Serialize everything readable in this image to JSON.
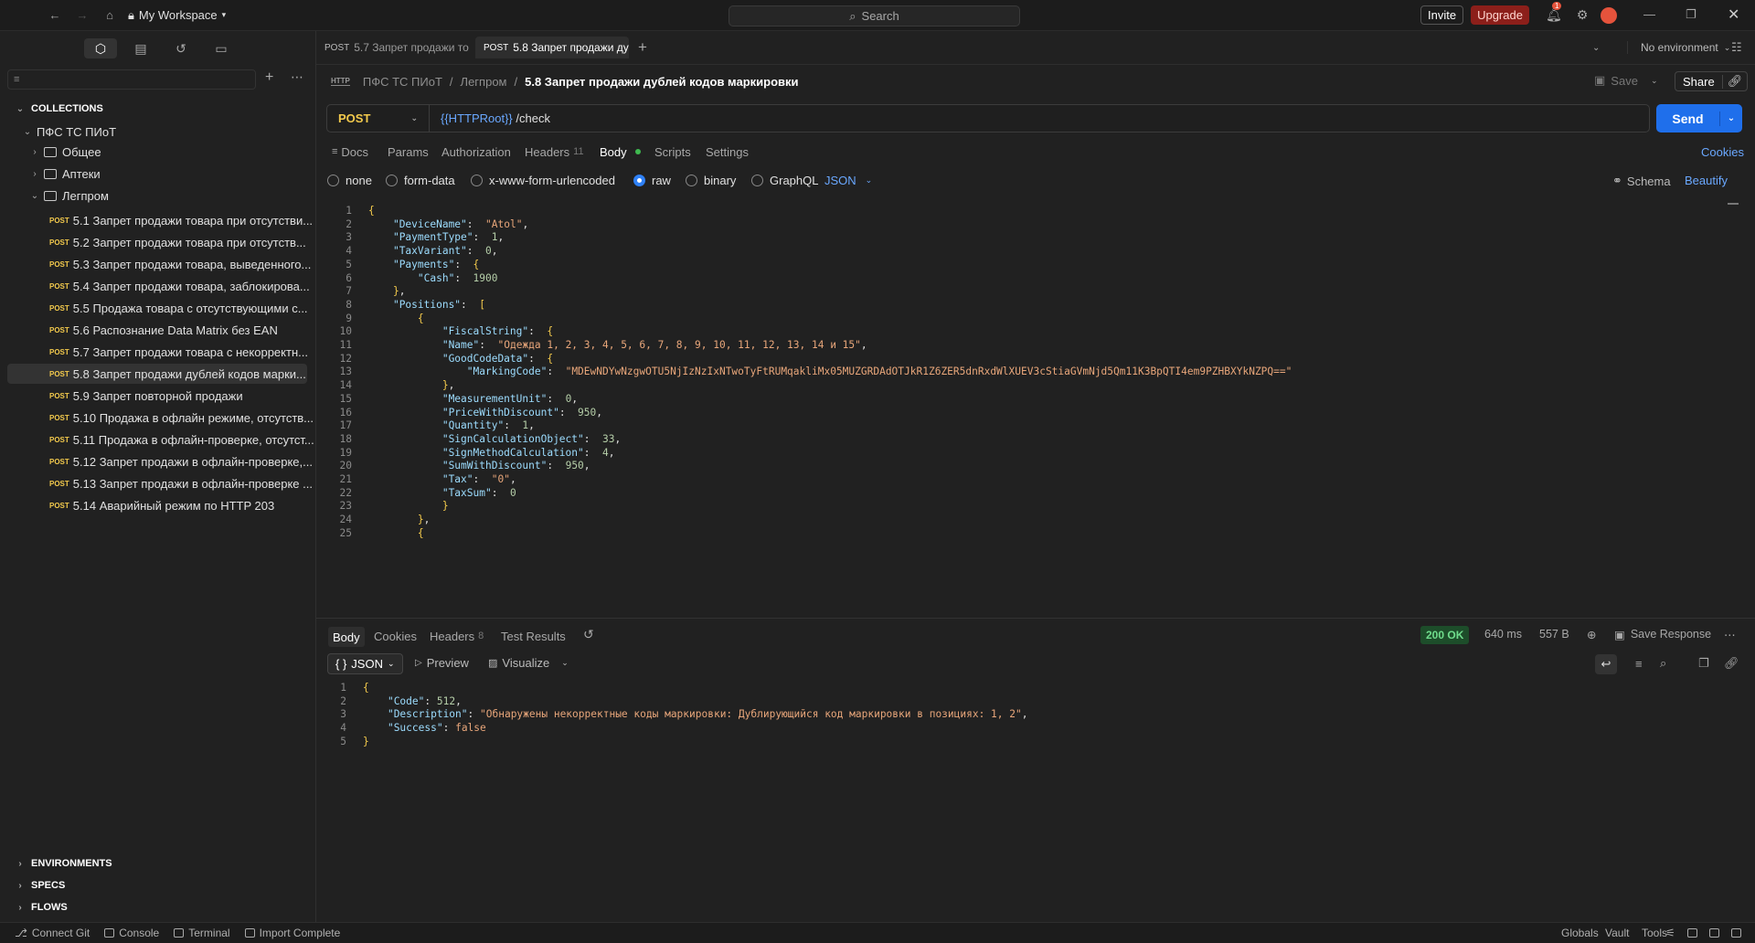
{
  "titlebar": {
    "workspace": "My Workspace",
    "search_placeholder": "Search",
    "invite": "Invite",
    "upgrade": "Upgrade",
    "notifications_count": "1"
  },
  "sidebar": {
    "sections": {
      "collections": "COLLECTIONS",
      "environments": "ENVIRONMENTS",
      "specs": "SPECS",
      "flows": "FLOWS"
    },
    "collection_name": "ПФС ТС ПИоТ",
    "folders": [
      "Общее",
      "Аптеки",
      "Легпром"
    ],
    "method_tag": "POST",
    "requests": [
      "5.1 Запрет продажи товара при отсутстви...",
      "5.2 Запрет продажи товара при отсутств...",
      "5.3 Запрет продажи товара, выведенного...",
      "5.4 Запрет продажи товара, заблокирова...",
      "5.5 Продажа товара с отсутствующими с...",
      "5.6 Распознание Data Matrix без EAN",
      "5.7 Запрет продажи товара с некорректн...",
      "5.8 Запрет продажи дублей кодов марки...",
      "5.9 Запрет повторной продажи",
      "5.10 Продажа в офлайн режиме, отсутств...",
      "5.11 Продажа в офлайн-проверке, отсутст...",
      "5.12 Запрет продажи в офлайн-проверке,...",
      "5.13 Запрет продажи в офлайн-проверке ...",
      "5.14 Аварийный режим по HTTP 203"
    ]
  },
  "tabs": [
    {
      "method": "POST",
      "label": "5.7 Запрет продажи то"
    },
    {
      "method": "POST",
      "label": "5.8 Запрет продажи ду"
    }
  ],
  "environment": "No environment",
  "breadcrumb": {
    "badge": "HTTP",
    "collection": "ПФС ТС ПИоТ",
    "folder": "Легпром",
    "current": "5.8 Запрет продажи дублей кодов маркировки"
  },
  "actions": {
    "save": "Save",
    "share": "Share"
  },
  "request": {
    "method": "POST",
    "url_var": "{{HTTPRoot}}",
    "url_path": " /check",
    "send": "Send",
    "cookies": "Cookies"
  },
  "request_tabs": [
    {
      "label": "Docs"
    },
    {
      "label": "Params"
    },
    {
      "label": "Authorization"
    },
    {
      "label": "Headers",
      "count": "11"
    },
    {
      "label": "Body"
    },
    {
      "label": "Scripts"
    },
    {
      "label": "Settings"
    }
  ],
  "body_options": [
    "none",
    "form-data",
    "x-www-form-urlencoded",
    "raw",
    "binary",
    "GraphQL"
  ],
  "body_format": "JSON",
  "schema": "Schema",
  "beautify": "Beautify",
  "request_body_lines": [
    "{",
    "    \"DeviceName\":  \"Atol\",",
    "    \"PaymentType\":  1,",
    "    \"TaxVariant\":  0,",
    "    \"Payments\":  {",
    "        \"Cash\":  1900",
    "    },",
    "    \"Positions\":  [",
    "        {",
    "            \"FiscalString\":  {",
    "            \"Name\":  \"Одежда 1, 2, 3, 4, 5, 6, 7, 8, 9, 10, 11, 12, 13, 14 и 15\",",
    "            \"GoodCodeData\":  {",
    "                \"MarkingCode\":  \"MDEwNDYwNzgwOTU5NjIzNzIxNTwoTyFtRUMqakliMx05MUZGRDAdOTJkR1Z6ZER5dnRxdWlXUEV3cStiaGVmNjd5Qm11K3BpQTI4em9PZHBXYkNZPQ==\"",
    "            },",
    "            \"MeasurementUnit\":  0,",
    "            \"PriceWithDiscount\":  950,",
    "            \"Quantity\":  1,",
    "            \"SignCalculationObject\":  33,",
    "            \"SignMethodCalculation\":  4,",
    "            \"SumWithDiscount\":  950,",
    "            \"Tax\":  \"0\",",
    "            \"TaxSum\":  0",
    "            }",
    "        },",
    "        {"
  ],
  "response": {
    "tabs": [
      {
        "label": "Body"
      },
      {
        "label": "Cookies"
      },
      {
        "label": "Headers",
        "count": "8"
      },
      {
        "label": "Test Results"
      }
    ],
    "status": "200 OK",
    "time": "640 ms",
    "size": "557 B",
    "save_response": "Save Response",
    "format": "JSON",
    "preview": "Preview",
    "visualize": "Visualize",
    "lines": [
      "{",
      "    \"Code\": 512,",
      "    \"Description\": \"Обнаружены некорректные коды маркировки: Дублирующийся код маркировки в позициях: 1, 2\",",
      "    \"Success\": false",
      "}"
    ]
  },
  "statusbar": {
    "connect_git": "Connect Git",
    "console": "Console",
    "terminal": "Terminal",
    "import": "Import Complete",
    "globals": "Globals",
    "vault": "Vault",
    "tools": "Tools"
  },
  "colors": {
    "accent": "#1f6feb",
    "post": "#f2c94c",
    "upgrade": "#8c1f1a",
    "ok": "#6fdc8c"
  }
}
